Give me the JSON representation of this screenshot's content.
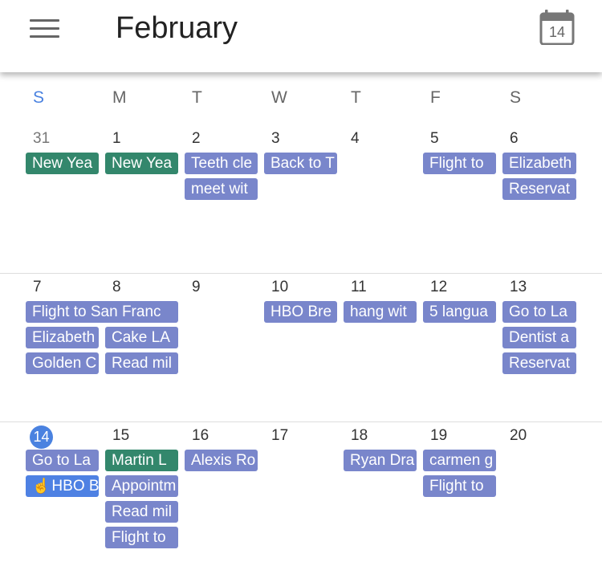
{
  "header": {
    "title": "February",
    "today_icon_number": "14"
  },
  "weekdays": [
    "S",
    "M",
    "T",
    "W",
    "T",
    "F",
    "S"
  ],
  "colors": {
    "event_default": "#7986cb",
    "event_holiday": "#33876c",
    "event_selected": "#4e81e3",
    "today_accent": "#4a82e0"
  },
  "weeks": [
    {
      "days": [
        "31",
        "1",
        "2",
        "3",
        "4",
        "5",
        "6"
      ]
    },
    {
      "days": [
        "7",
        "8",
        "9",
        "10",
        "11",
        "12",
        "13"
      ]
    },
    {
      "days": [
        "14",
        "15",
        "16",
        "17",
        "18",
        "19",
        "20"
      ]
    }
  ],
  "events": {
    "w1": [
      "New Yea",
      "New Yea",
      "Teeth cle",
      "meet wit",
      "Back to T",
      "Flight to",
      "Elizabeth",
      "Reservat"
    ],
    "w2": [
      "Flight to San Franc",
      "Elizabeth",
      "Cake LA",
      "Golden C",
      "Read mil",
      "HBO Bre",
      "hang wit",
      "5 langua",
      "Go to La",
      "Dentist a",
      "Reservat"
    ],
    "w3": [
      "Go to La",
      "HBO B",
      "Martin L",
      "Appointm",
      "Read mil",
      "Flight to",
      "Alexis Ro",
      "Ryan Dra",
      "carmen g",
      "Flight to"
    ]
  }
}
